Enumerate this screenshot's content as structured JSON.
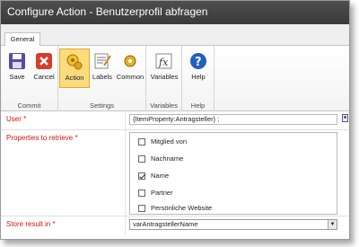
{
  "window": {
    "title": "Configure Action - Benutzerprofil abfragen"
  },
  "tabs": [
    {
      "label": "General"
    }
  ],
  "ribbon": {
    "groups": [
      {
        "label": "Commit",
        "buttons": [
          {
            "label": "Save",
            "icon": "save-icon"
          },
          {
            "label": "Cancel",
            "icon": "cancel-icon"
          }
        ]
      },
      {
        "label": "Settings",
        "buttons": [
          {
            "label": "Action",
            "icon": "action-icon"
          },
          {
            "label": "Labels",
            "icon": "labels-icon"
          },
          {
            "label": "Common",
            "icon": "common-icon"
          }
        ]
      },
      {
        "label": "Variables",
        "buttons": [
          {
            "label": "Variables",
            "icon": "function-icon"
          }
        ]
      },
      {
        "label": "Help",
        "buttons": [
          {
            "label": "Help",
            "icon": "help-icon"
          }
        ]
      }
    ]
  },
  "form": {
    "user": {
      "label": "User *",
      "value": "{ItemProperty:Antragsteller} ;"
    },
    "properties": {
      "label": "Properties to retrieve *",
      "items": [
        {
          "label": "Mitglied von",
          "checked": false
        },
        {
          "label": "Nachname",
          "checked": false
        },
        {
          "label": "Name",
          "checked": true
        },
        {
          "label": "Partner",
          "checked": false
        },
        {
          "label": "Persönliche Website",
          "checked": false
        }
      ]
    },
    "store": {
      "label": "Store result in *",
      "value": "varAntragstellerName"
    }
  },
  "colors": {
    "active_button": "#fbdc7c",
    "required_label": "#dd1111",
    "title_bar": "#444444"
  }
}
